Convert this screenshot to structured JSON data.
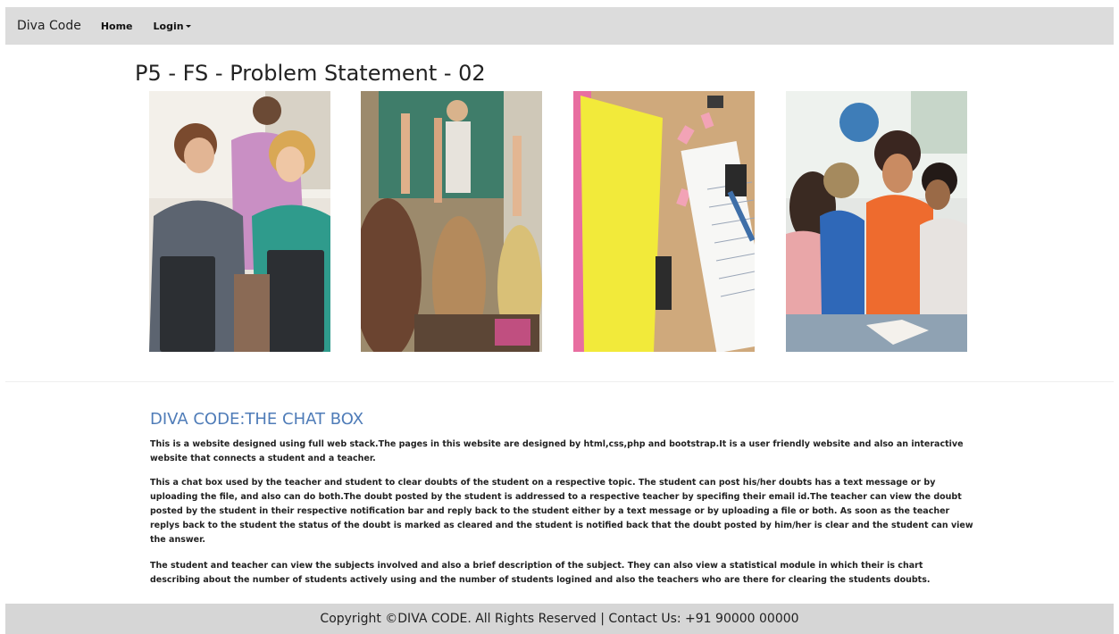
{
  "navbar": {
    "brand": "Diva Code",
    "home_label": "Home",
    "login_label": "Login"
  },
  "page": {
    "title": "P5 - FS - Problem Statement - 02"
  },
  "gallery": {
    "images": [
      {
        "name": "students-with-laptops-photo"
      },
      {
        "name": "classroom-raised-hands-photo"
      },
      {
        "name": "notebook-and-folder-photo"
      },
      {
        "name": "teacher-reading-with-children-photo"
      }
    ]
  },
  "about": {
    "title": "DIVA CODE:THE CHAT BOX",
    "paragraphs": [
      "This is a website designed using full web stack.The pages in this website are designed by html,css,php and bootstrap.It is a user friendly website and also an interactive website that connects a student and a teacher.",
      "This a chat box used by the teacher and student to clear doubts of the student on a respective topic. The student can post his/her doubts has a text message or by uploading the file, and also can do both.The doubt posted by the student is addressed to a respective teacher by specifing their email id.The teacher can view the doubt posted by the student in their respective notification bar and reply back to the student either by a text message or by uploading a file or both. As soon as the teacher replys back to the student the status of the doubt is marked as cleared and the student is notified back that the doubt posted by him/her is clear and the student can view the answer.",
      "The student and teacher can view the subjects involved and also a brief description of the subject. They can also view a statistical module in which their is chart describing about the number of students actively using and the number of students logined and also the teachers who are there for clearing the students doubts."
    ]
  },
  "footer": {
    "text": "Copyright ©DIVA CODE. All Rights Reserved | Contact Us: +91 90000 00000"
  },
  "colors": {
    "navbar_bg": "#dcdcdc",
    "footer_bg": "#d6d6d6",
    "about_title": "#4f7cb8"
  }
}
